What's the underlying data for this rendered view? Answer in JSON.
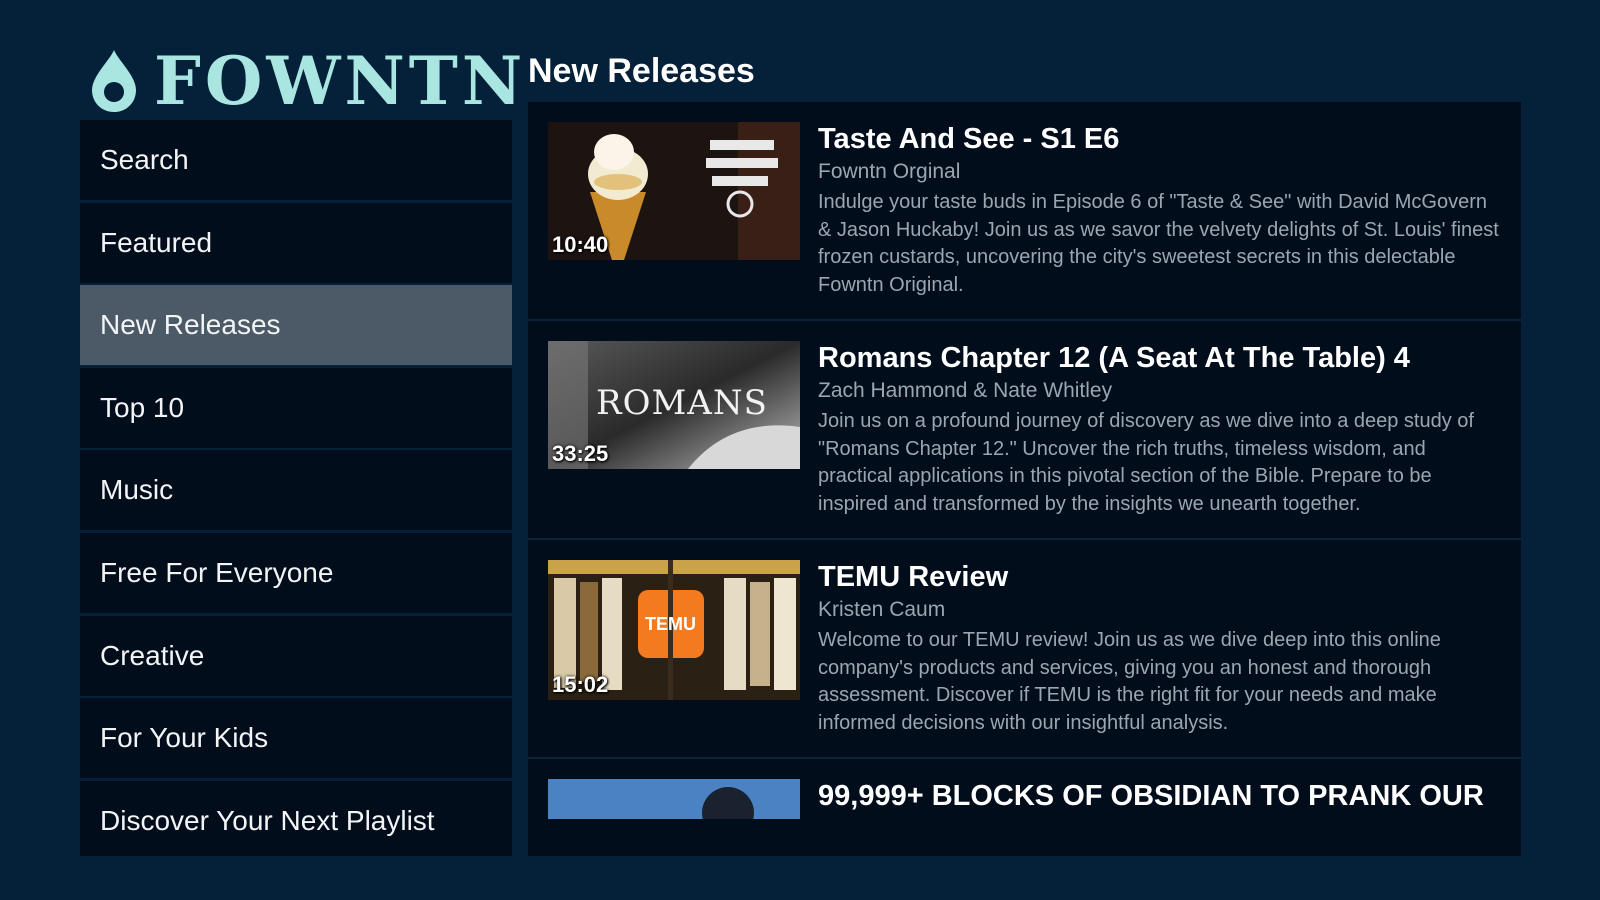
{
  "brand": {
    "name": "FOWNTN",
    "logo_icon": "droplet-icon",
    "accent_color": "#a9e6e2"
  },
  "sidebar": {
    "items": [
      {
        "label": "Search"
      },
      {
        "label": "Featured"
      },
      {
        "label": "New Releases",
        "active": true
      },
      {
        "label": "Top 10"
      },
      {
        "label": "Music"
      },
      {
        "label": "Free For Everyone"
      },
      {
        "label": "Creative"
      },
      {
        "label": "For Your Kids"
      },
      {
        "label": "Discover Your Next Playlist"
      }
    ]
  },
  "main": {
    "section_title": "New Releases",
    "videos": [
      {
        "title": "Taste And See - S1 E6",
        "author": "Fowntn Orginal",
        "duration": "10:40",
        "description": "Indulge your taste buds in Episode 6 of \"Taste & See\" with David McGovern & Jason Huckaby! Join us as we savor the velvety delights of St. Louis' finest frozen custards, uncovering the city's sweetest secrets in this delectable Fowntn Original."
      },
      {
        "title": "Romans Chapter 12 (A Seat At The Table) 4",
        "author": "Zach Hammond & Nate Whitley",
        "duration": "33:25",
        "thumb_text": "ROMANS",
        "description": "Join us on a profound journey of discovery as we dive into a deep study of \"Romans Chapter 12.\" Uncover the rich truths, timeless wisdom, and practical applications in this pivotal section of the Bible. Prepare to be inspired and transformed by the insights we unearth together."
      },
      {
        "title": "TEMU Review",
        "author": "Kristen Caum",
        "duration": "15:02",
        "thumb_text": "TEMU",
        "description": "Welcome to our TEMU review! Join us as we dive deep into this online company's products and services, giving you an honest and thorough assessment. Discover if TEMU is the right fit for your needs and make informed decisions with our insightful analysis."
      },
      {
        "title": "99,999+ BLOCKS OF OBSIDIAN TO PRANK OUR",
        "author": "",
        "duration": "",
        "description": ""
      }
    ]
  }
}
